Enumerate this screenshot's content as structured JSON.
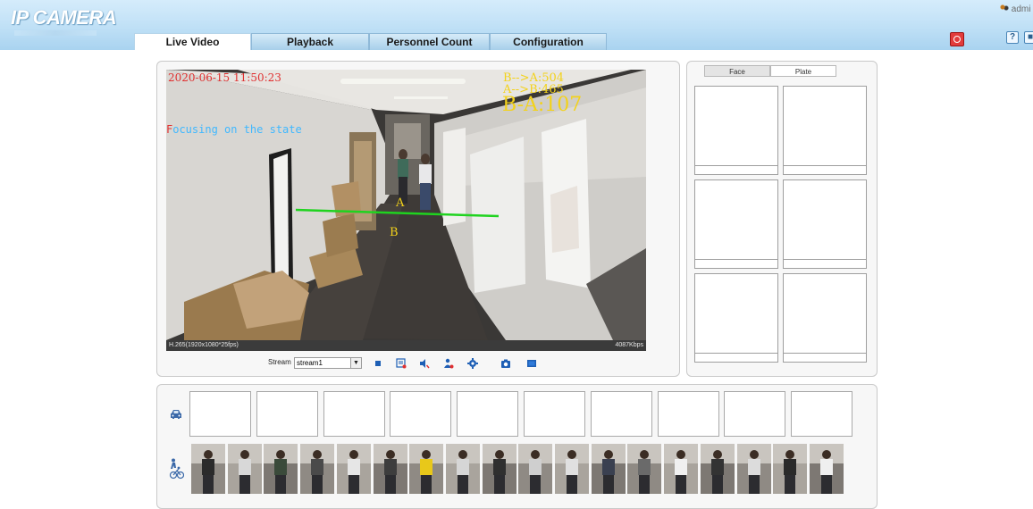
{
  "header": {
    "logo": "IP CAMERA",
    "user": "admi",
    "tabs": [
      {
        "label": "Live Video",
        "active": true
      },
      {
        "label": "Playback",
        "active": false
      },
      {
        "label": "Personnel Count",
        "active": false
      },
      {
        "label": "Configuration",
        "active": false
      }
    ],
    "icons": [
      "alarm-icon",
      "help-icon",
      "logout-icon",
      "user-icon"
    ]
  },
  "video": {
    "timestamp": "2020-06-15 11:50:23",
    "focus_prefix": "F",
    "focus_text": "ocusing on the state",
    "count_b_to_a": "B-->A:504",
    "count_a_to_b": "A-->B:465",
    "count_diff": "B-A:107",
    "line_label_a": "A",
    "line_label_b": "B",
    "status_left": "H.265(1920x1080*25fps)",
    "status_right": "4087Kbps"
  },
  "toolbar": {
    "stream_label": "Stream",
    "stream_value": "stream1",
    "icons": [
      "stop-icon",
      "record-icon",
      "audio-icon",
      "talk-icon",
      "settings-icon",
      "snapshot-icon",
      "fullscreen-icon"
    ]
  },
  "capture": {
    "tabs": [
      {
        "label": "Face",
        "active": true
      },
      {
        "label": "Plate",
        "active": false
      }
    ]
  },
  "bottom": {
    "vehicle_slots": 10,
    "pedestrian_thumbs": 18
  },
  "colors": {
    "header_bg": "#bfe0f6",
    "overlay_yellow": "#f3d21a",
    "overlay_red": "#e03030",
    "overlay_blue": "#40b8ff",
    "count_line": "#1fd31f"
  }
}
